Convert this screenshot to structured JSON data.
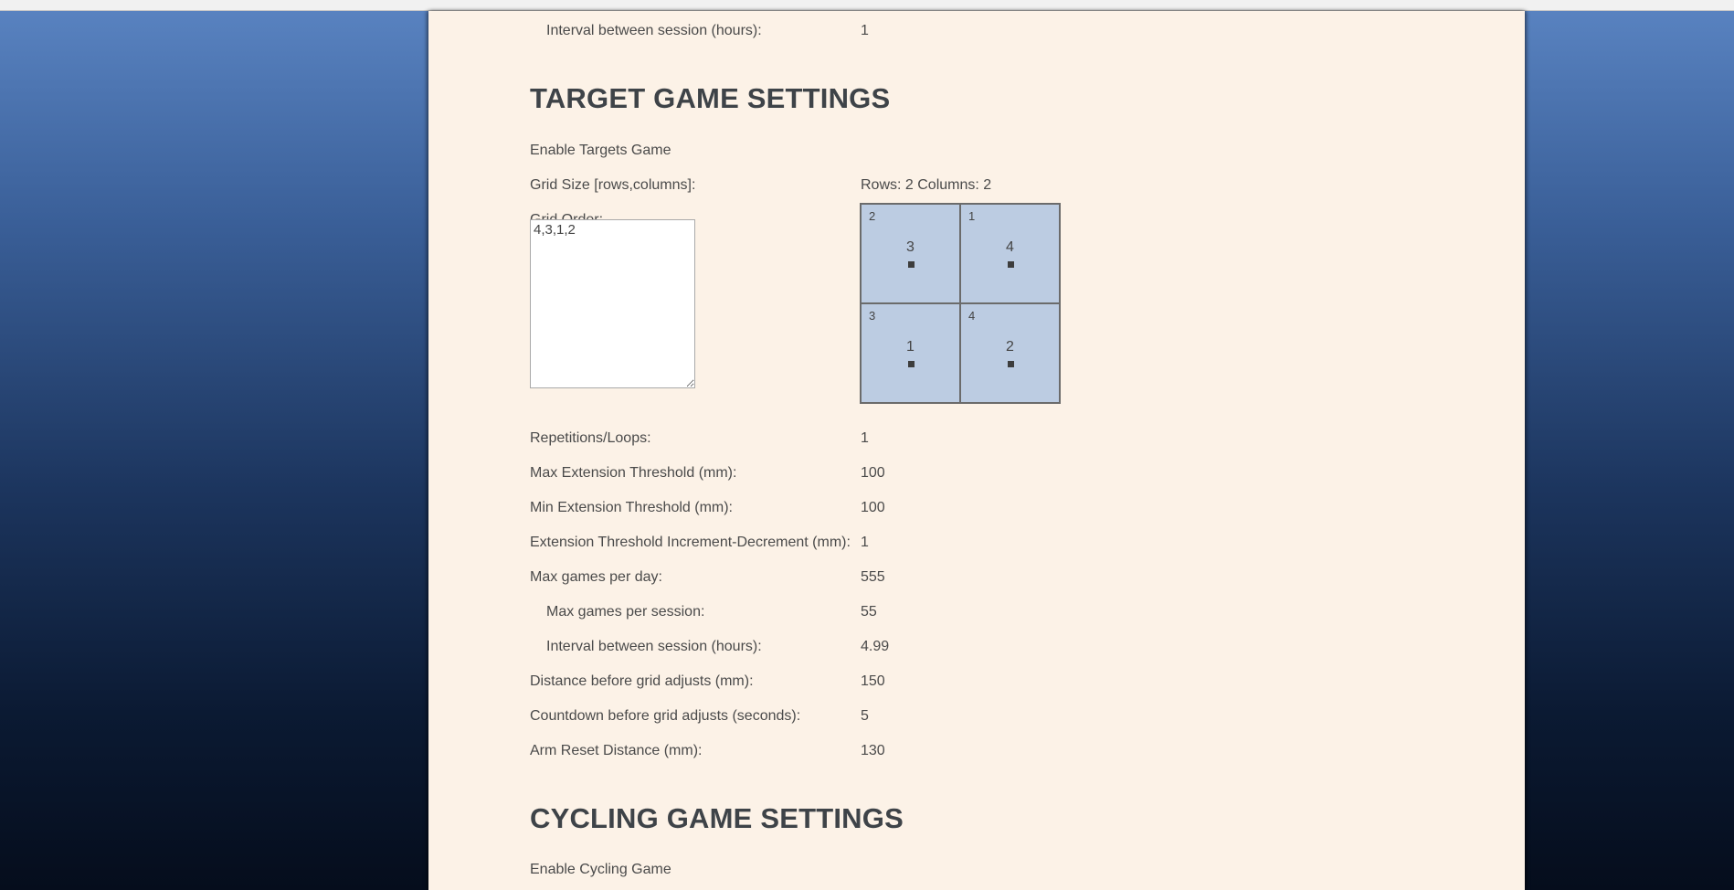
{
  "top_row": {
    "label": "Interval between session (hours):",
    "value": "1"
  },
  "target_section": {
    "heading": "TARGET GAME SETTINGS",
    "enable_label": "Enable Targets Game",
    "grid_size": {
      "label": "Grid Size [rows,columns]:",
      "value": "Rows: 2 Columns: 2"
    },
    "grid_order": {
      "label": "Grid Order:",
      "value": "4,3,1,2",
      "cells": [
        {
          "corner": "2",
          "center": "3"
        },
        {
          "corner": "1",
          "center": "4"
        },
        {
          "corner": "3",
          "center": "1"
        },
        {
          "corner": "4",
          "center": "2"
        }
      ]
    },
    "settings": [
      {
        "label": "Repetitions/Loops:",
        "value": "1",
        "indent": false
      },
      {
        "label": "Max Extension Threshold (mm):",
        "value": "100",
        "indent": false
      },
      {
        "label": "Min Extension Threshold (mm):",
        "value": "100",
        "indent": false
      },
      {
        "label": "Extension Threshold Increment-Decrement (mm):",
        "value": "1",
        "indent": false
      },
      {
        "label": "Max games per day:",
        "value": "555",
        "indent": false
      },
      {
        "label": "Max games per session:",
        "value": "55",
        "indent": true
      },
      {
        "label": "Interval between session (hours):",
        "value": "4.99",
        "indent": true
      },
      {
        "label": "Distance before grid adjusts (mm):",
        "value": "150",
        "indent": false
      },
      {
        "label": "Countdown before grid adjusts (seconds):",
        "value": "5",
        "indent": false
      },
      {
        "label": "Arm Reset Distance (mm):",
        "value": "130",
        "indent": false
      }
    ]
  },
  "cycling_section": {
    "heading": "CYCLING GAME SETTINGS",
    "enable_label": "Enable Cycling Game"
  }
}
